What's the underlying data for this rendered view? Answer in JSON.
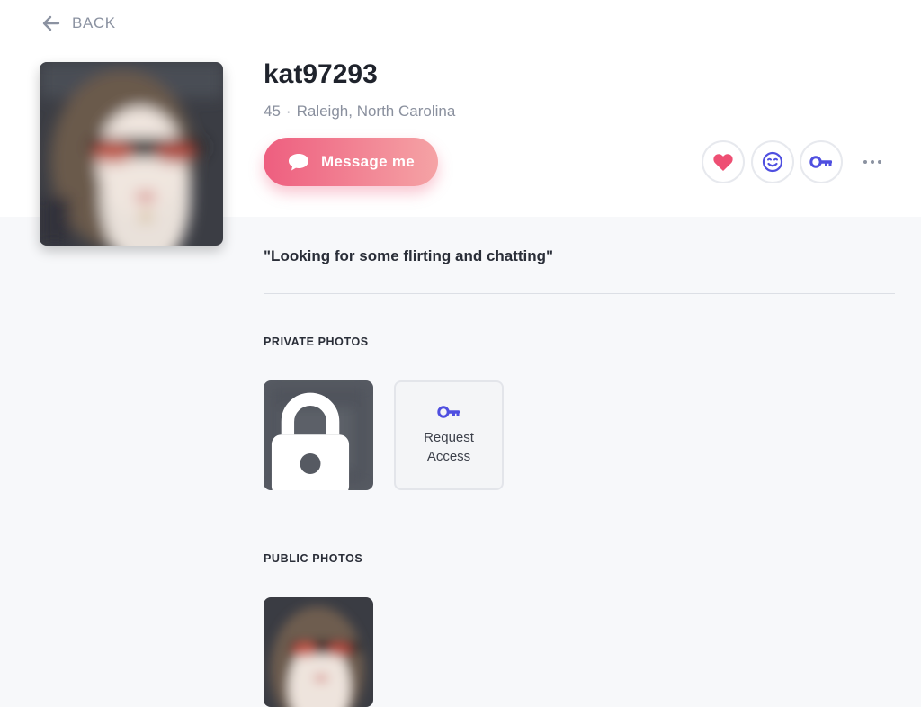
{
  "nav": {
    "back_label": "BACK"
  },
  "profile": {
    "username": "kat97293",
    "age": "45",
    "separator": "·",
    "location": "Raleigh, North Carolina",
    "headline": "\"Looking for some flirting and chatting\""
  },
  "actions": {
    "message_label": "Message me",
    "like_icon": "heart-icon",
    "wink_icon": "wink-smiley-icon",
    "key_icon": "key-icon",
    "more_icon": "more-dots-icon"
  },
  "private_photos": {
    "title": "PRIVATE PHOTOS",
    "request_label": "Request Access",
    "lock_icon": "lock-icon"
  },
  "public_photos": {
    "title": "PUBLIC PHOTOS"
  },
  "colors": {
    "accent_pink": "#ee5e7f",
    "accent_blue": "#4f4fe0",
    "muted_text": "#8a909e",
    "page_bg": "#f7f8fa"
  }
}
